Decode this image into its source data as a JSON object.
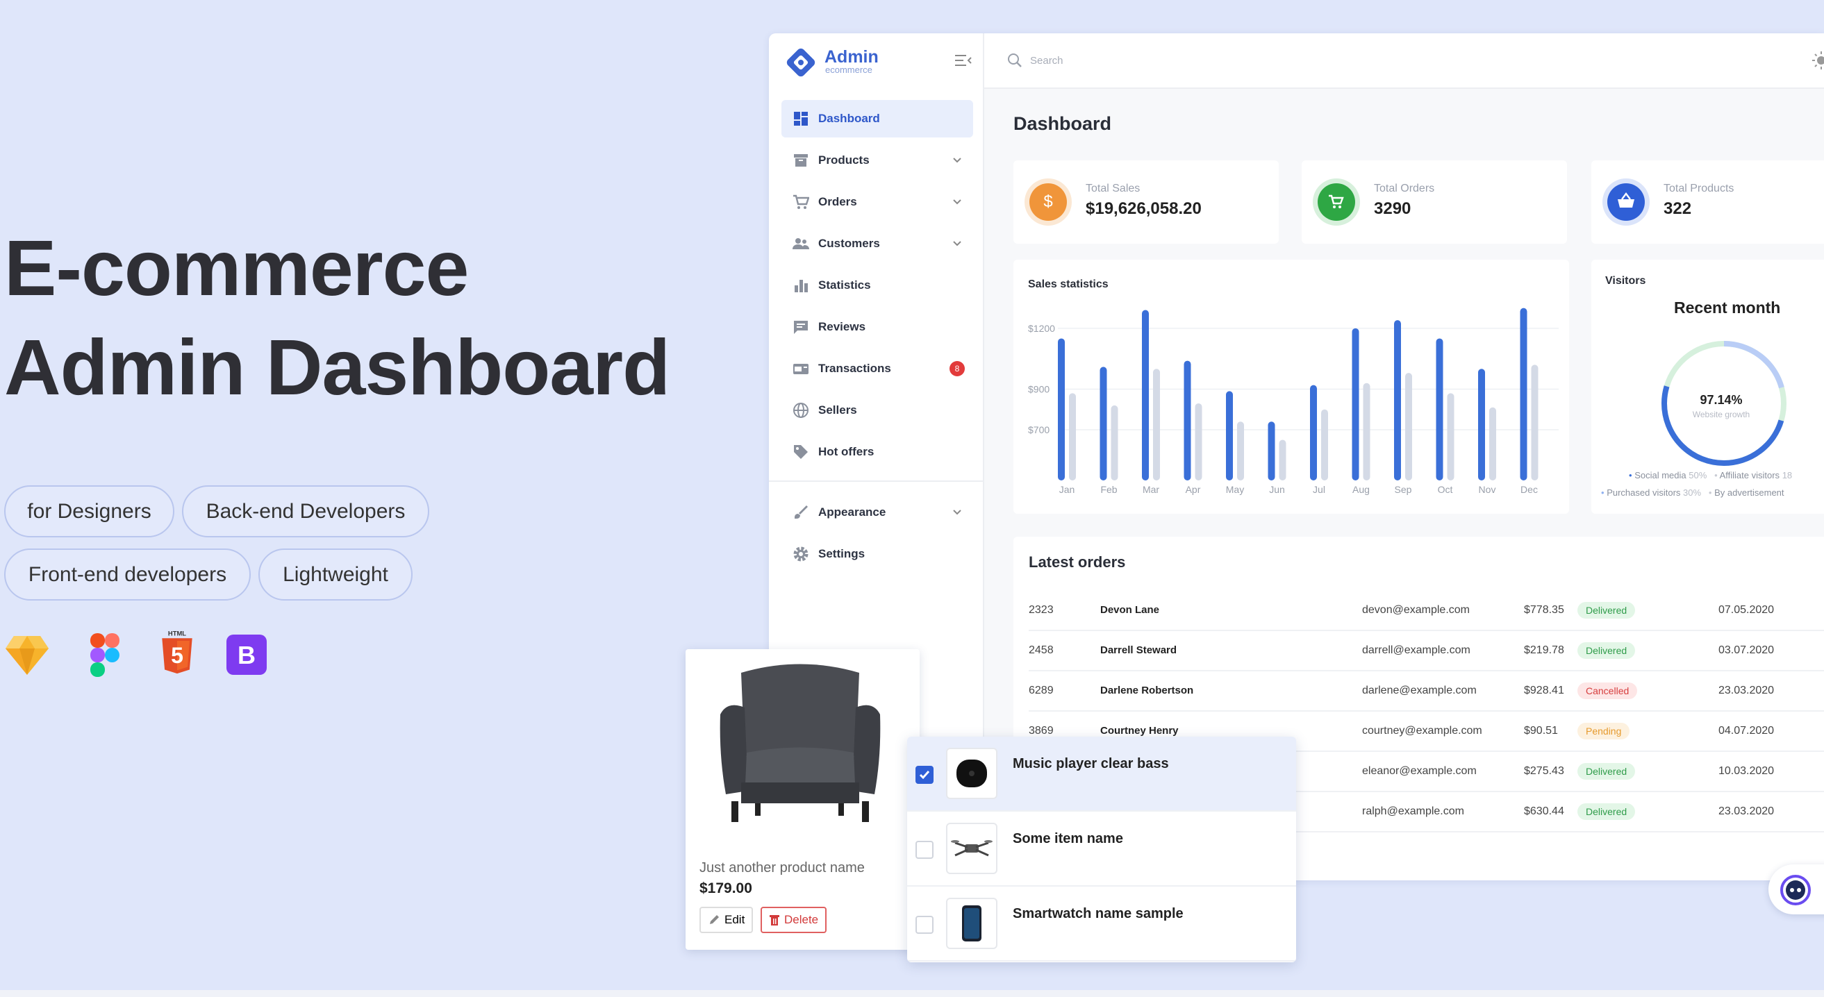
{
  "hero": {
    "title_line1": "E-commerce",
    "title_line2": "Admin Dashboard",
    "tags": [
      "for Designers",
      "Back-end Developers",
      "Front-end developers",
      "Lightweight"
    ],
    "tech_icons": [
      "sketch-icon",
      "figma-icon",
      "html5-icon",
      "bootstrap-icon"
    ],
    "html5_caption": "HTML",
    "bootstrap_letter": "B"
  },
  "brand": {
    "name": "Admin",
    "sub": "ecommerce",
    "accent": "#3a63cf"
  },
  "sidebar": {
    "items": [
      {
        "label": "Dashboard",
        "icon": "dashboard-icon",
        "active": true
      },
      {
        "label": "Products",
        "icon": "box-icon",
        "has_chevron": true
      },
      {
        "label": "Orders",
        "icon": "cart-icon",
        "has_chevron": true
      },
      {
        "label": "Customers",
        "icon": "people-icon",
        "has_chevron": true
      },
      {
        "label": "Statistics",
        "icon": "bar-chart-icon"
      },
      {
        "label": "Reviews",
        "icon": "comment-icon"
      },
      {
        "label": "Transactions",
        "icon": "card-icon",
        "badge": "8"
      },
      {
        "label": "Sellers",
        "icon": "globe-icon"
      },
      {
        "label": "Hot offers",
        "icon": "tag-icon"
      }
    ],
    "bottom_items": [
      {
        "label": "Appearance",
        "icon": "brush-icon",
        "has_chevron": true
      },
      {
        "label": "Settings",
        "icon": "gear-icon"
      }
    ]
  },
  "topbar": {
    "search_placeholder": "Search"
  },
  "page": {
    "title": "Dashboard"
  },
  "stats": [
    {
      "label": "Total Sales",
      "value": "$19,626,058.20",
      "icon_glyph": "$",
      "color": "#f0953a",
      "ring": "#fbe8d4"
    },
    {
      "label": "Total Orders",
      "value": "3290",
      "icon": "cart-icon",
      "color": "#2ea744",
      "ring": "#d7f0dc"
    },
    {
      "label": "Total Products",
      "value": "322",
      "icon": "basket-icon",
      "color": "#2f5fd6",
      "ring": "#dbe4fa"
    }
  ],
  "sales_chart": {
    "title": "Sales statistics",
    "y_ticks": [
      "$1200",
      "$900",
      "$700"
    ],
    "months": [
      "Jan",
      "Feb",
      "Mar",
      "Apr",
      "May",
      "Jun",
      "Jul",
      "Aug",
      "Sep",
      "Oct",
      "Nov",
      "Dec"
    ]
  },
  "chart_data": {
    "type": "bar",
    "title": "Sales statistics",
    "categories": [
      "Jan",
      "Feb",
      "Mar",
      "Apr",
      "May",
      "Jun",
      "Jul",
      "Aug",
      "Sep",
      "Oct",
      "Nov",
      "Dec"
    ],
    "series": [
      {
        "values": [
          1150,
          1010,
          1290,
          1040,
          890,
          740,
          920,
          1200,
          1240,
          1150,
          1000,
          1300
        ],
        "color": "#3a6fd8"
      },
      {
        "values": [
          880,
          820,
          1000,
          830,
          740,
          650,
          800,
          930,
          980,
          880,
          810,
          1020
        ],
        "color": "#d4dae6"
      }
    ],
    "ylim": [
      450,
      1350
    ],
    "y_ticks": [
      1200,
      900,
      700
    ],
    "grid": true
  },
  "visitors": {
    "title": "Visitors",
    "subtitle": "Recent month",
    "percent": "97.14%",
    "caption": "Website growth",
    "legend_rows": [
      [
        {
          "label": "Social media",
          "value": "50%",
          "color": "#3a6fd8"
        },
        {
          "label": "Affiliate visitors",
          "value": "18",
          "color": "#c9ccd4"
        }
      ],
      [
        {
          "label": "Purchased visitors",
          "value": "30%",
          "color": "#8fb0ef"
        },
        {
          "label": "By advertisement",
          "value": "",
          "color": "#c9ccd4"
        }
      ]
    ]
  },
  "latest_orders": {
    "title": "Latest orders",
    "rows": [
      {
        "id": "2323",
        "name": "Devon Lane",
        "email": "devon@example.com",
        "amount": "$778.35",
        "status": "Delivered",
        "date": "07.05.2020"
      },
      {
        "id": "2458",
        "name": "Darrell Steward",
        "email": "darrell@example.com",
        "amount": "$219.78",
        "status": "Delivered",
        "date": "03.07.2020"
      },
      {
        "id": "6289",
        "name": "Darlene Robertson",
        "email": "darlene@example.com",
        "amount": "$928.41",
        "status": "Cancelled",
        "date": "23.03.2020"
      },
      {
        "id": "3869",
        "name": "Courtney Henry",
        "email": "courtney@example.com",
        "amount": "$90.51",
        "status": "Pending",
        "date": "04.07.2020"
      },
      {
        "id": "",
        "name": "",
        "email": "eleanor@example.com",
        "amount": "$275.43",
        "status": "Delivered",
        "date": "10.03.2020"
      },
      {
        "id": "",
        "name": "",
        "email": "ralph@example.com",
        "amount": "$630.44",
        "status": "Delivered",
        "date": "23.03.2020"
      }
    ]
  },
  "product_card": {
    "name": "Just another product name",
    "price": "$179.00",
    "edit_label": "Edit",
    "delete_label": "Delete"
  },
  "item_list": [
    {
      "name": "Music player clear bass",
      "checked": true,
      "thumb": "speaker-icon"
    },
    {
      "name": "Some item name",
      "checked": false,
      "thumb": "drone-icon"
    },
    {
      "name": "Smartwatch name sample",
      "checked": false,
      "thumb": "phone-icon"
    }
  ]
}
